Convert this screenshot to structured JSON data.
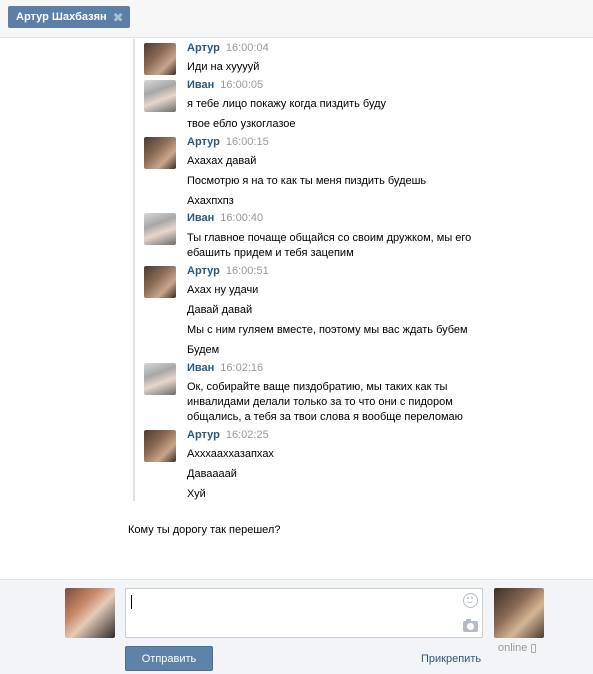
{
  "tab": {
    "title": "Артур Шахбазян",
    "close": "✖"
  },
  "messages": [
    {
      "author": "Артур",
      "time": "16:00:04",
      "avatar": "artur",
      "lines": [
        "Иди на хууууй"
      ]
    },
    {
      "author": "Иван",
      "time": "16:00:05",
      "avatar": "ivan",
      "lines": [
        "я тебе лицо покажу когда пиздить буду",
        "твое ебло узкоглазое"
      ]
    },
    {
      "author": "Артур",
      "time": "16:00:15",
      "avatar": "artur",
      "lines": [
        "Ахахах давай",
        "Посмотрю я на то как ты меня пиздить будешь",
        "Ахахпхпз"
      ]
    },
    {
      "author": "Иван",
      "time": "16:00:40",
      "avatar": "ivan",
      "lines": [
        "Ты главное почаще общайся со своим дружком, мы его",
        "ебашить придем и тебя зацепим"
      ]
    },
    {
      "author": "Артур",
      "time": "16:00:51",
      "avatar": "artur",
      "lines": [
        "Ахах ну удачи",
        "Давай давай",
        "Мы с ним гуляем вместе, поэтому мы вас ждать бубем",
        "Будем"
      ]
    },
    {
      "author": "Иван",
      "time": "16:02:16",
      "avatar": "ivan",
      "lines": [
        "Ок, собирайте ваще пиздобратию, мы таких как ты",
        "инвалидами делали только за то что они с пидором",
        "общались, а тебя за твои слова я вообще переломаю"
      ]
    },
    {
      "author": "Артур",
      "time": "16:02:25",
      "avatar": "artur",
      "lines": [
        "Ахххаахха­запхах",
        "Даваааай",
        "Хуй"
      ]
    }
  ],
  "pending": "Кому ты дорогу так перешел?",
  "composer": {
    "send_label": "Отправить",
    "attach_label": "Прикрепить",
    "online_label": "online",
    "input_value": ""
  },
  "colors": {
    "accent": "#5b7fa6",
    "author": "#2b587a",
    "time": "#999999"
  }
}
